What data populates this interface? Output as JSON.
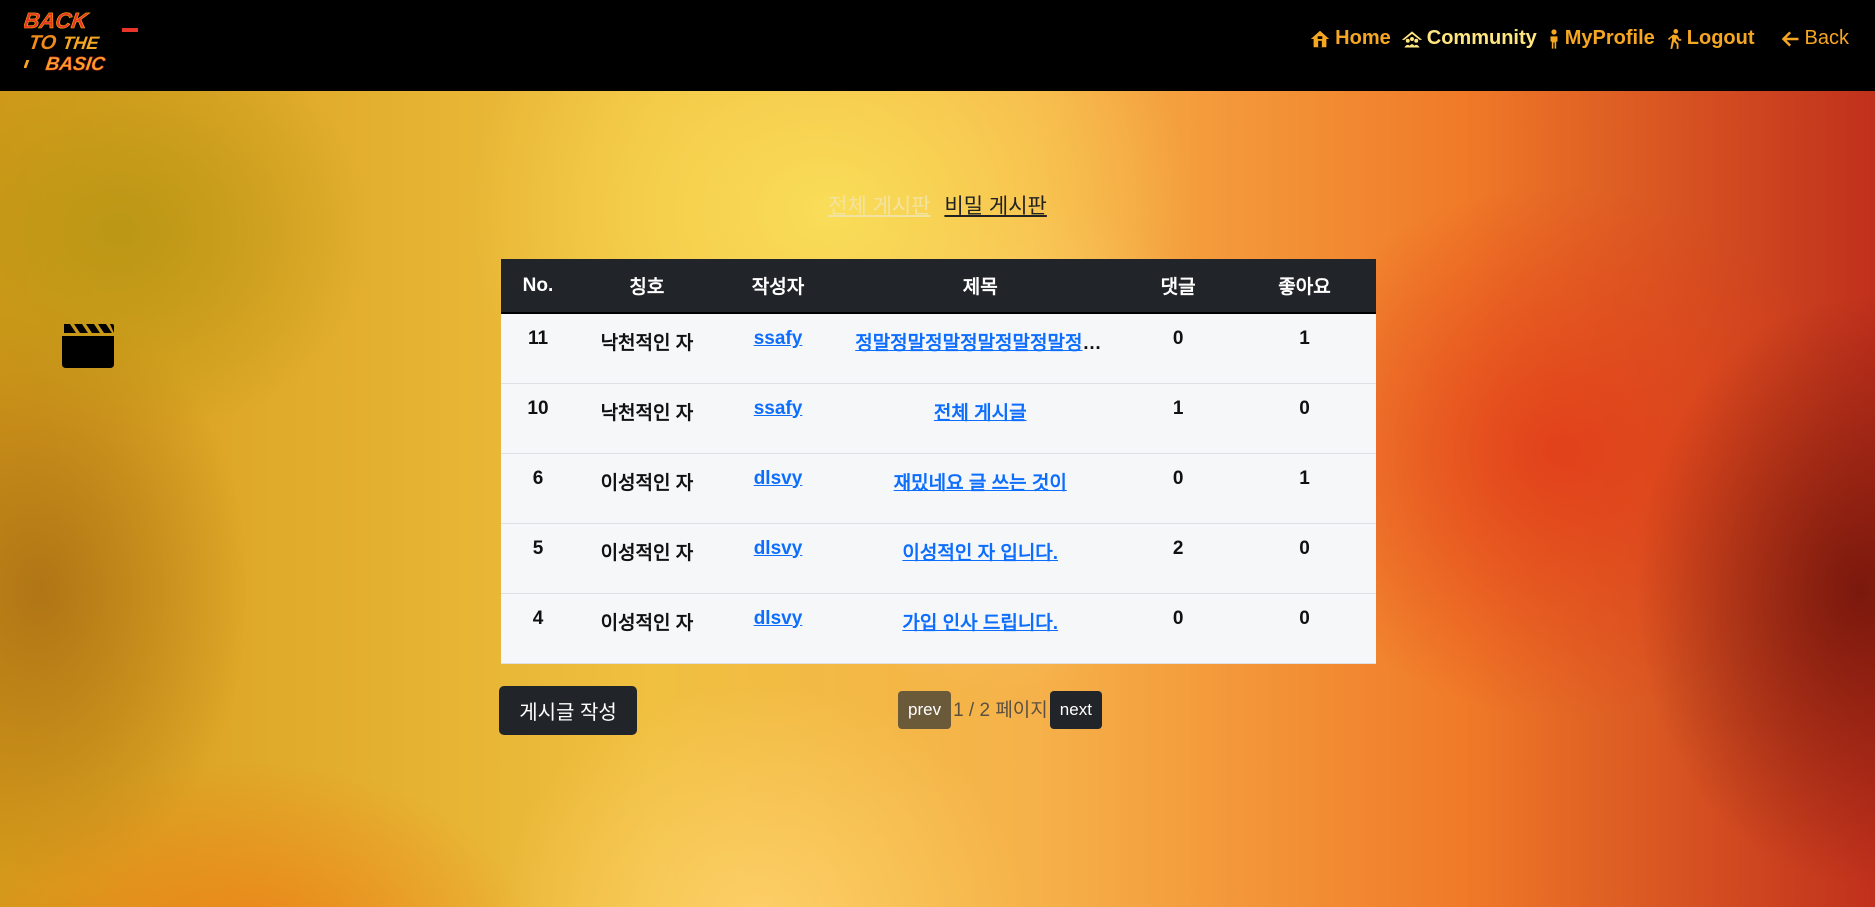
{
  "nav": {
    "logo_text": "BACK TO THE BASIC",
    "links": [
      {
        "label": "Home",
        "icon": "home-icon",
        "color": "#f5a623"
      },
      {
        "label": "Community",
        "icon": "community-icon",
        "color": "#ffe680"
      },
      {
        "label": "MyProfile",
        "icon": "person-icon",
        "color": "#f5a623"
      },
      {
        "label": "Logout",
        "icon": "running-person-icon",
        "color": "#f5a623"
      },
      {
        "label": "Back",
        "icon": "arrow-left-icon",
        "color": "#f5a623"
      }
    ]
  },
  "tabs": {
    "all": "전체 게시판",
    "secret": "비밀 게시판"
  },
  "side_icon": "clapperboard-icon",
  "table": {
    "headers": [
      "No.",
      "칭호",
      "작성자",
      "제목",
      "댓글",
      "좋아요"
    ],
    "rows": [
      {
        "no": "11",
        "title_name": "낙천적인 자",
        "author": "ssafy",
        "subject": "정말정말정말정말정말정말정말정말",
        "comments": "0",
        "likes": "1"
      },
      {
        "no": "10",
        "title_name": "낙천적인 자",
        "author": "ssafy",
        "subject": "전체 게시글",
        "comments": "1",
        "likes": "0"
      },
      {
        "no": "6",
        "title_name": "이성적인 자",
        "author": "dlsvy",
        "subject": "재밌네요 글 쓰는 것이",
        "comments": "0",
        "likes": "1"
      },
      {
        "no": "5",
        "title_name": "이성적인 자",
        "author": "dlsvy",
        "subject": "이성적인 자 입니다.",
        "comments": "2",
        "likes": "0"
      },
      {
        "no": "4",
        "title_name": "이성적인 자",
        "author": "dlsvy",
        "subject": "가입 인사 드립니다.",
        "comments": "0",
        "likes": "0"
      }
    ]
  },
  "actions": {
    "write_label": "게시글 작성"
  },
  "pager": {
    "prev_label": "prev",
    "info": "1 / 2 페이지",
    "next_label": "next"
  }
}
